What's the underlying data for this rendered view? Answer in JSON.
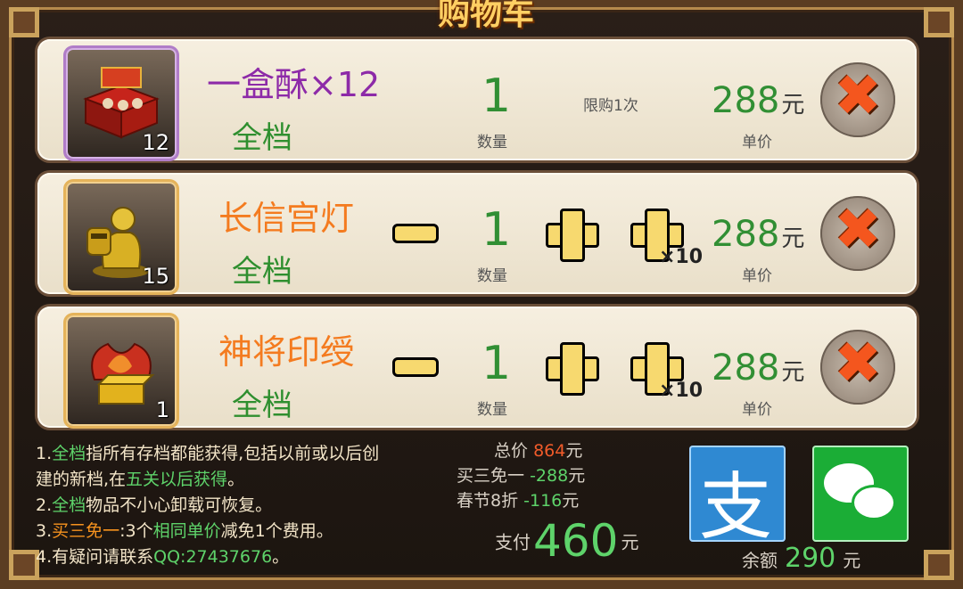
{
  "title": "购物车",
  "items": [
    {
      "name": "一盒酥×12",
      "tier": "全档",
      "count_badge": "12",
      "quantity": "1",
      "quantity_label": "数量",
      "limit_text": "限购1次",
      "price": "288",
      "price_unit": "元",
      "price_label": "单价",
      "frame_color": "#b07cc8"
    },
    {
      "name": "长信宫灯",
      "tier": "全档",
      "count_badge": "15",
      "quantity": "1",
      "quantity_label": "数量",
      "plus10_label": "×10",
      "price": "288",
      "price_unit": "元",
      "price_label": "单价",
      "frame_color": "#e5b35a"
    },
    {
      "name": "神将印绶",
      "tier": "全档",
      "count_badge": "1",
      "quantity": "1",
      "quantity_label": "数量",
      "plus10_label": "×10",
      "price": "288",
      "price_unit": "元",
      "price_label": "单价",
      "frame_color": "#e5b35a"
    }
  ],
  "notes": {
    "line1_prefix": "1.",
    "line1_green": "全档",
    "line1_text": "指所有存档都能获得,包括以前或以后创",
    "line2_text": "建的新档,在",
    "line2_green": "五关以后获得",
    "line2_end": "。",
    "line3_prefix": "2.",
    "line3_green": "全档",
    "line3_text": "物品不小心卸载可恢复。",
    "line4_prefix": "3.",
    "line4_orange": "买三免一",
    "line4_mid": ":3个",
    "line4_green": "相同单价",
    "line4_end": "减免1个费用。",
    "line5_text": "4.有疑问请联系",
    "line5_green": "QQ:27437676",
    "line5_end": "。"
  },
  "summary": {
    "total_label": "总价",
    "total_value": "864",
    "total_unit": "元",
    "promo_label": "买三免一",
    "promo_value": "-288",
    "promo_unit": "元",
    "festival_label": "春节8折",
    "festival_value": "-116",
    "festival_unit": "元"
  },
  "payment": {
    "pay_label": "支付",
    "pay_amount": "460",
    "pay_unit": "元",
    "alipay_glyph": "支",
    "balance_label": "余额",
    "balance_value": "290",
    "balance_unit": "元"
  },
  "colors": {
    "price_green": "#318f34",
    "accent_orange": "#f47b1f",
    "accent_purple": "#8d2aa8",
    "alipay_blue": "#2f89d2",
    "wechat_green": "#1bad36"
  }
}
